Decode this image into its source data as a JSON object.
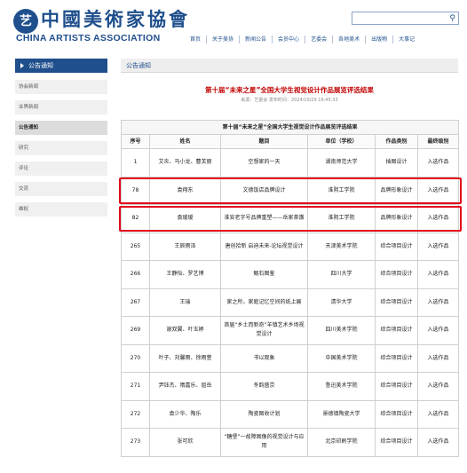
{
  "header": {
    "logo_mark": "艺",
    "logo_cn": "中國美術家協會",
    "logo_en": "CHINA ARTISTS ASSOCIATION",
    "search_placeholder": "",
    "search_icon": "search-icon"
  },
  "nav": {
    "items": [
      "首页",
      "关于美协",
      "新闻公告",
      "会员中心",
      "艺委会",
      "各地美术",
      "出版物",
      "大事记"
    ]
  },
  "sidebar": {
    "title": "公告通知",
    "items": [
      "协会新闻",
      "业界新闻",
      "公告通知",
      "研究",
      "评论",
      "交流",
      "维权"
    ],
    "active_index": 2
  },
  "main": {
    "crumb": "公告通知",
    "article_title": "第十届“未来之星”全国大学生视觉设计作品展览评选结果",
    "article_meta": "来源：艺委会  发布时间：2024/10/29 16:45:33",
    "table_caption": "第十届“未来之星”全国大学生视觉设计作品展览评选结果",
    "columns": [
      "序号",
      "姓名",
      "题目",
      "单位（学校）",
      "作品类别",
      "最终级别"
    ],
    "rows": [
      [
        "1",
        "艾炎、马小龙、曹芙丽",
        "空想家的一天",
        "湖南师范大学",
        "插图设计",
        "入选作品"
      ],
      [
        "78",
        "袁翔东",
        "文德饭店品牌设计",
        "淮阴工学院",
        "品牌形象设计",
        "入选作品"
      ],
      [
        "82",
        "袁瑷瑷",
        "淮安老字号品牌重塑——岳家茶馓",
        "淮阴工学院",
        "品牌形象设计",
        "入选作品"
      ],
      [
        "265",
        "王辰雨泽",
        "唐创拾新 启迪未来-论坛视觉设计",
        "天津美术学院",
        "综合项目设计",
        "入选作品"
      ],
      [
        "266",
        "王静怡、罗艺博",
        "甄石图鉴",
        "四川大学",
        "综合项目设计",
        "入选作品"
      ],
      [
        "267",
        "王瑞",
        "家之所，家庭记忆空间的纸上展",
        "清华大学",
        "综合项目设计",
        "入选作品"
      ],
      [
        "269",
        "谢双翼、叶玉婷",
        "首届“乡土而新奇”羊镇艺术乡场视觉设计",
        "四川美术学院",
        "综合项目设计",
        "入选作品"
      ],
      [
        "270",
        "叶子、刘馨雨、徐雨萱",
        "书以观象",
        "中国美术学院",
        "综合项目设计",
        "入选作品"
      ],
      [
        "271",
        "尹钰杰、隋嘉乐、屈岳",
        "冬韵盛京",
        "鲁迅美术学院",
        "综合项目设计",
        "入选作品"
      ],
      [
        "272",
        "袁少华、陶乐",
        "陶瓷图收计划",
        "景德镇陶瓷大学",
        "综合项目设计",
        "入选作品"
      ],
      [
        "273",
        "张可欣",
        "“糖堡”一故障图像的视觉设计与应用",
        "北京印刷学院",
        "综合项目设计",
        "入选作品"
      ]
    ],
    "highlighted_rows": [
      1,
      2
    ],
    "highlight_color": "#e0001a"
  },
  "colors": {
    "brand": "#1f4f8c",
    "title_red": "#c00000"
  }
}
